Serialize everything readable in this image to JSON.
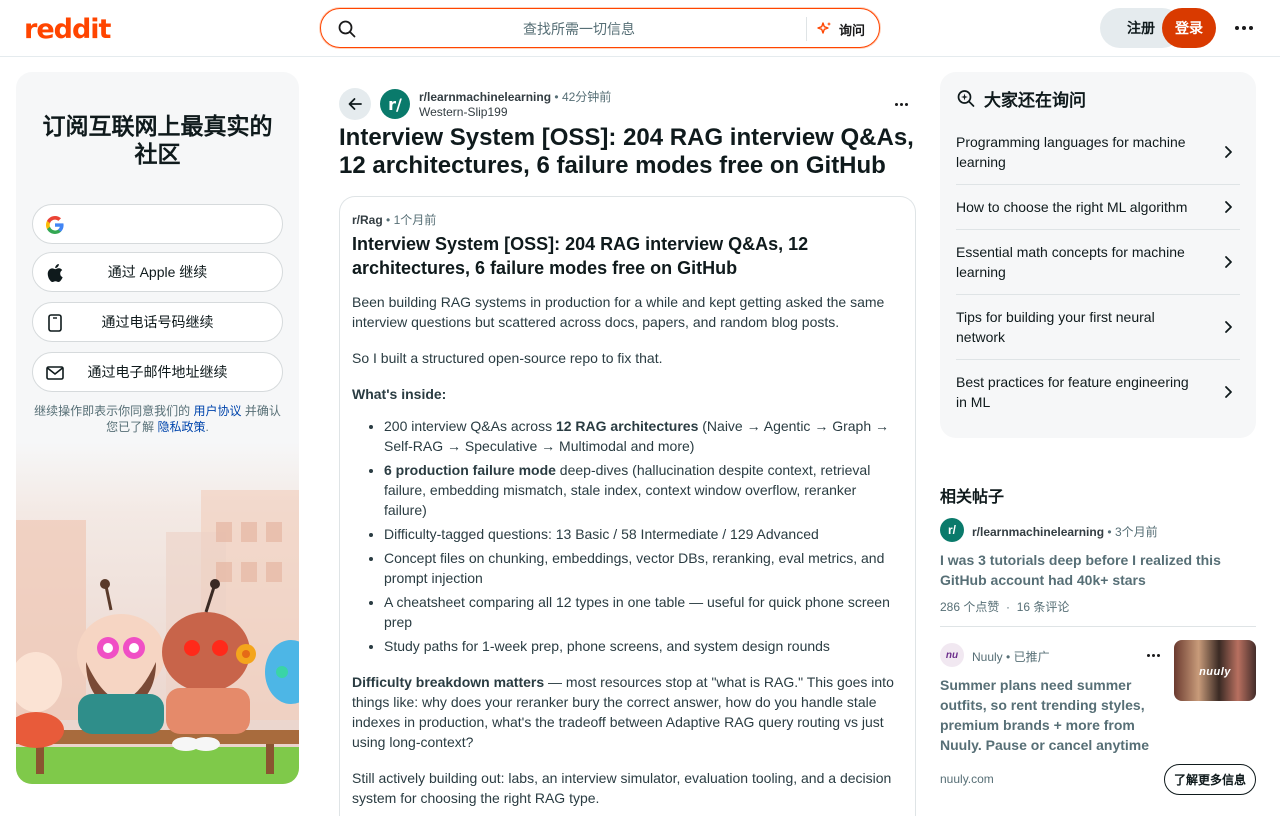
{
  "header": {
    "logo": "reddit",
    "search_placeholder": "查找所需一切信息",
    "ask_label": "询问",
    "signup_label": "注册",
    "login_label": "登录"
  },
  "left_card": {
    "title": "订阅互联网上最真实的社区",
    "apple_label": "通过 Apple 继续",
    "phone_label": "通过电话号码继续",
    "email_label": "通过电子邮件地址继续",
    "legal_prefix": "继续操作即表示你同意我们的",
    "terms_link": "用户协议",
    "legal_mid": "并确认您已了解",
    "privacy_link": "隐私政策",
    "legal_suffix": "."
  },
  "post": {
    "subreddit": "r/learnmachinelearning",
    "age": "42分钟前",
    "author": "Western-Slip199",
    "title": "Interview System [OSS]: 204 RAG interview Q&As, 12 architectures, 6 failure modes free on GitHub",
    "embed": {
      "subreddit": "r/Rag",
      "age": "1个月前",
      "title": "Interview System [OSS]: 204 RAG interview Q&As, 12 architectures, 6 failure modes free on GitHub",
      "p1": "Been building RAG systems in production for a while and kept getting asked the same interview questions but scattered across docs, papers, and random blog posts.",
      "p2": "So I built a structured open-source repo to fix that.",
      "inside_heading": "What's inside:",
      "bullets": [
        {
          "pre": "200 interview Q&As across ",
          "bold": "12 RAG architectures",
          "post": " (Naive → Agentic → Graph → Self-RAG → Speculative → Multimodal and more)"
        },
        {
          "pre": "",
          "bold": "6 production failure mode",
          "post": " deep-dives (hallucination despite context, retrieval failure, embedding mismatch, stale index, context window overflow, reranker failure)"
        },
        {
          "pre": "Difficulty-tagged questions: 13 Basic / 58 Intermediate / 129 Advanced",
          "bold": "",
          "post": ""
        },
        {
          "pre": "Concept files on chunking, embeddings, vector DBs, reranking, eval metrics, and prompt injection",
          "bold": "",
          "post": ""
        },
        {
          "pre": "A cheatsheet comparing all 12 types in one table — useful for quick phone screen prep",
          "bold": "",
          "post": ""
        },
        {
          "pre": "Study paths for 1-week prep, phone screens, and system design rounds",
          "bold": "",
          "post": ""
        }
      ],
      "difficulty_bold": "Difficulty breakdown matters",
      "difficulty_rest": " — most resources stop at \"what is RAG.\" This goes into things like: why does your reranker bury the correct answer, how do you handle stale indexes in production, what's the tradeoff between Adaptive RAG query routing vs just using long-context?",
      "p_last": "Still actively building out: labs, an interview simulator, evaluation tooling, and a decision system for choosing the right RAG type."
    }
  },
  "ask_card": {
    "title": "大家还在询问",
    "items": [
      "Programming languages for machine learning",
      "How to choose the right ML algorithm",
      "Essential math concepts for machine learning",
      "Tips for building your first neural network",
      "Best practices for feature engineering in ML"
    ]
  },
  "related": {
    "title": "相关帖子",
    "post": {
      "subreddit": "r/learnmachinelearning",
      "age": "3个月前",
      "title": "I was 3 tutorials deep before I realized this GitHub account had 40k+ stars",
      "upvotes": "286 个点赞",
      "comments": "16 条评论"
    }
  },
  "ad": {
    "avatar_text": "nu",
    "advertiser": "Nuuly",
    "promoted": "已推广",
    "title": "Summer plans need summer outfits, so rent trending styles, premium brands + more from Nuuly. Pause or cancel anytime",
    "image_text": "nuuly",
    "domain": "nuuly.com",
    "cta": "了解更多信息"
  },
  "colors": {
    "brand": "#ff4500",
    "login_bg": "#d93a00",
    "link": "#0045ac"
  }
}
